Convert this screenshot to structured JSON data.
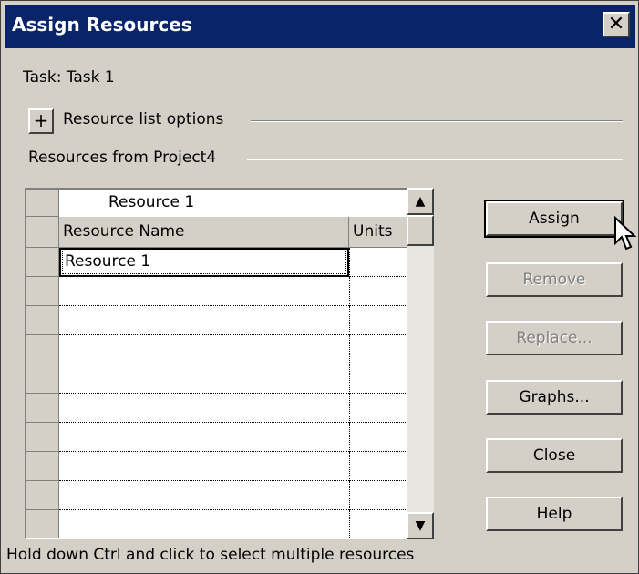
{
  "dialog": {
    "title": "Assign Resources",
    "close_glyph": "✕",
    "task_label": "Task: Task 1",
    "options_toggle": "+",
    "options_label": "Resource list options",
    "resources_label": "Resources from Project4",
    "footer_hint": "Hold down Ctrl and click to select multiple resources"
  },
  "grid": {
    "edit_value": "Resource 1",
    "columns": [
      "Resource Name",
      "Units"
    ],
    "rows": [
      {
        "name": "Resource 1",
        "units": ""
      },
      {
        "name": "",
        "units": ""
      },
      {
        "name": "",
        "units": ""
      },
      {
        "name": "",
        "units": ""
      },
      {
        "name": "",
        "units": ""
      },
      {
        "name": "",
        "units": ""
      },
      {
        "name": "",
        "units": ""
      },
      {
        "name": "",
        "units": ""
      },
      {
        "name": "",
        "units": ""
      },
      {
        "name": "",
        "units": ""
      }
    ]
  },
  "scrollbar": {
    "up_glyph": "▲",
    "down_glyph": "▼"
  },
  "buttons": {
    "assign": "Assign",
    "remove": "Remove",
    "replace": "Replace...",
    "graphs": "Graphs...",
    "close": "Close",
    "help": "Help"
  },
  "colors": {
    "titlebar": "#0a246a",
    "face": "#d4d0c8",
    "disabled_text": "#808080"
  }
}
